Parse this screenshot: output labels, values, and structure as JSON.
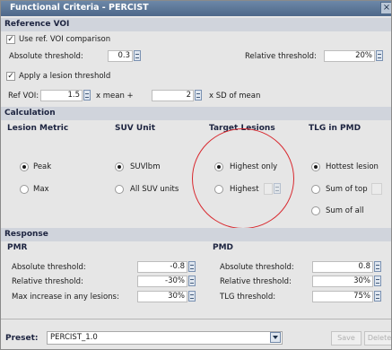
{
  "window": {
    "title": "Functional Criteria - PERCIST",
    "close_glyph": "×"
  },
  "reference_voi": {
    "header": "Reference VOI",
    "use_ref_label": "Use ref. VOI comparison",
    "abs_label": "Absolute threshold:",
    "abs_value": "0.3",
    "rel_label": "Relative threshold:",
    "rel_value": "20%",
    "apply_label": "Apply a lesion threshold",
    "refvoi_label": "Ref VOI:",
    "mean_value": "1.5",
    "mean_suffix": "x mean +",
    "sd_value": "2",
    "sd_suffix": "x SD of mean"
  },
  "calculation": {
    "header": "Calculation",
    "lesion_metric": {
      "title": "Lesion Metric",
      "options": [
        "Peak",
        "Max"
      ]
    },
    "suv_unit": {
      "title": "SUV Unit",
      "options": [
        "SUVlbm",
        "All SUV units"
      ]
    },
    "target_lesions": {
      "title": "Target Lesions",
      "options": [
        "Highest only",
        "Highest"
      ]
    },
    "tlg_pmd": {
      "title": "TLG in PMD",
      "options": [
        "Hottest lesion",
        "Sum of top",
        "Sum of all"
      ]
    }
  },
  "response": {
    "header": "Response",
    "pmr": {
      "title": "PMR",
      "abs_label": "Absolute threshold:",
      "abs_value": "-0.8",
      "rel_label": "Relative threshold:",
      "rel_value": "-30%",
      "max_label": "Max increase in any lesions:",
      "max_value": "30%"
    },
    "pmd": {
      "title": "PMD",
      "abs_label": "Absolute threshold:",
      "abs_value": "0.8",
      "rel_label": "Relative threshold:",
      "rel_value": "30%",
      "tlg_label": "TLG threshold:",
      "tlg_value": "75%"
    }
  },
  "footer": {
    "preset_label": "Preset:",
    "preset_value": "PERCIST_1.0",
    "save_label": "Save",
    "delete_label": "Delete"
  },
  "colors": {
    "title_bar": "#5a7596",
    "section_header": "#d0d4dc",
    "annotation_circle": "#d8282e"
  }
}
